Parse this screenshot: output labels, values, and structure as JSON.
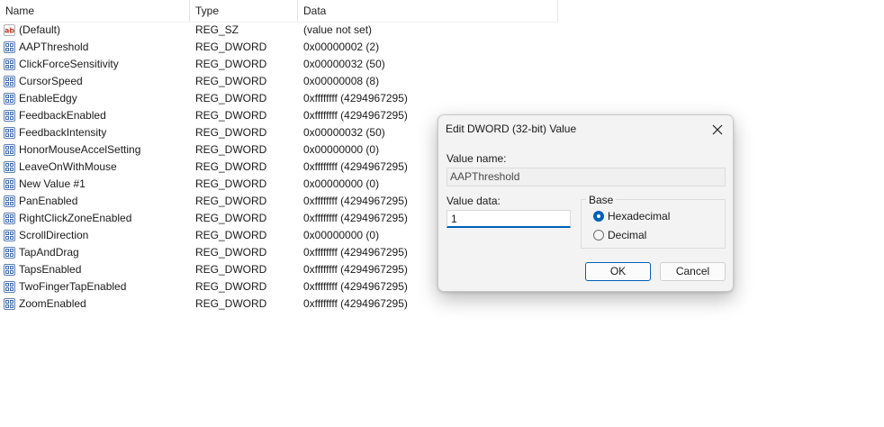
{
  "columns": {
    "name": "Name",
    "type": "Type",
    "data": "Data"
  },
  "rows": [
    {
      "icon": "string-value-icon",
      "name": "(Default)",
      "type": "REG_SZ",
      "data": "(value not set)"
    },
    {
      "icon": "binary-value-icon",
      "name": "AAPThreshold",
      "type": "REG_DWORD",
      "data": "0x00000002 (2)"
    },
    {
      "icon": "binary-value-icon",
      "name": "ClickForceSensitivity",
      "type": "REG_DWORD",
      "data": "0x00000032 (50)"
    },
    {
      "icon": "binary-value-icon",
      "name": "CursorSpeed",
      "type": "REG_DWORD",
      "data": "0x00000008 (8)"
    },
    {
      "icon": "binary-value-icon",
      "name": "EnableEdgy",
      "type": "REG_DWORD",
      "data": "0xffffffff (4294967295)"
    },
    {
      "icon": "binary-value-icon",
      "name": "FeedbackEnabled",
      "type": "REG_DWORD",
      "data": "0xffffffff (4294967295)"
    },
    {
      "icon": "binary-value-icon",
      "name": "FeedbackIntensity",
      "type": "REG_DWORD",
      "data": "0x00000032 (50)"
    },
    {
      "icon": "binary-value-icon",
      "name": "HonorMouseAccelSetting",
      "type": "REG_DWORD",
      "data": "0x00000000 (0)"
    },
    {
      "icon": "binary-value-icon",
      "name": "LeaveOnWithMouse",
      "type": "REG_DWORD",
      "data": "0xffffffff (4294967295)"
    },
    {
      "icon": "binary-value-icon",
      "name": "New Value #1",
      "type": "REG_DWORD",
      "data": "0x00000000 (0)"
    },
    {
      "icon": "binary-value-icon",
      "name": "PanEnabled",
      "type": "REG_DWORD",
      "data": "0xffffffff (4294967295)"
    },
    {
      "icon": "binary-value-icon",
      "name": "RightClickZoneEnabled",
      "type": "REG_DWORD",
      "data": "0xffffffff (4294967295)"
    },
    {
      "icon": "binary-value-icon",
      "name": "ScrollDirection",
      "type": "REG_DWORD",
      "data": "0x00000000 (0)"
    },
    {
      "icon": "binary-value-icon",
      "name": "TapAndDrag",
      "type": "REG_DWORD",
      "data": "0xffffffff (4294967295)"
    },
    {
      "icon": "binary-value-icon",
      "name": "TapsEnabled",
      "type": "REG_DWORD",
      "data": "0xffffffff (4294967295)"
    },
    {
      "icon": "binary-value-icon",
      "name": "TwoFingerTapEnabled",
      "type": "REG_DWORD",
      "data": "0xffffffff (4294967295)"
    },
    {
      "icon": "binary-value-icon",
      "name": "ZoomEnabled",
      "type": "REG_DWORD",
      "data": "0xffffffff (4294967295)"
    }
  ],
  "dialog": {
    "title": "Edit DWORD (32-bit) Value",
    "close_icon": "close-icon",
    "value_name_label": "Value name:",
    "value_name": "AAPThreshold",
    "value_data_label": "Value data:",
    "value_data": "1",
    "base_label": "Base",
    "base_options": [
      {
        "label": "Hexadecimal",
        "selected": true
      },
      {
        "label": "Decimal",
        "selected": false
      }
    ],
    "ok_label": "OK",
    "cancel_label": "Cancel",
    "accent_color": "#005fb8"
  }
}
